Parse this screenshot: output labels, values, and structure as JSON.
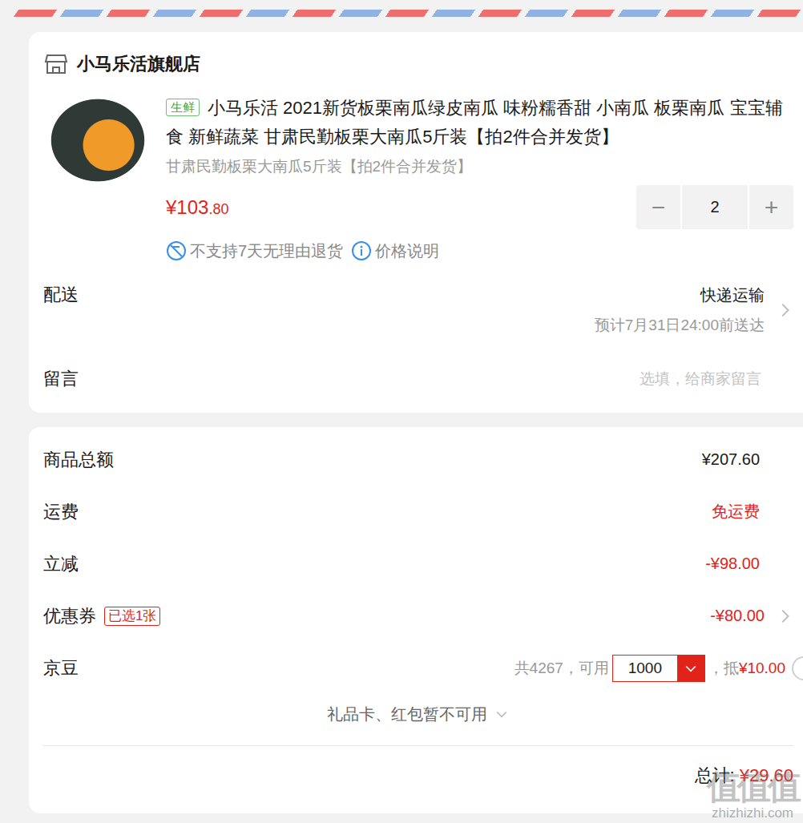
{
  "store": {
    "name": "小马乐活旗舰店"
  },
  "product": {
    "tag": "生鲜",
    "title": "小马乐活 2021新货板栗南瓜绿皮南瓜 味粉糯香甜 小南瓜 板栗南瓜 宝宝辅食 新鲜蔬菜 甘肃民勤板栗大南瓜5斤装【拍2件合并发货】",
    "spec": "甘肃民勤板栗大南瓜5斤装【拍2件合并发货】",
    "price_main": "¥103",
    "price_decimal": ".80",
    "quantity": "2",
    "minus": "−",
    "plus": "+",
    "notices": [
      {
        "label": "不支持7天无理由退货",
        "kind": "no-return"
      },
      {
        "label": "价格说明",
        "kind": "info"
      }
    ]
  },
  "delivery": {
    "label": "配送",
    "method": "快递运输",
    "eta": "预计7月31日24:00前送达"
  },
  "message": {
    "label": "留言",
    "placeholder": "选填，给商家留言"
  },
  "summary": [
    {
      "label": "商品总额",
      "value": "¥207.60",
      "kind": "plain"
    },
    {
      "label": "运费",
      "value": "免运费",
      "kind": "discount"
    },
    {
      "label": "立减",
      "value": "-¥98.00",
      "kind": "discount"
    },
    {
      "label": "优惠券",
      "badge": "已选1张",
      "value": "-¥80.00",
      "kind": "coupon"
    }
  ],
  "beans": {
    "label": "京豆",
    "available": "共4267，可用",
    "amount": "1000",
    "offset_prefix": "，抵",
    "offset": "¥10.00",
    "checked": false
  },
  "gift": {
    "label": "礼品卡、红包暂不可用"
  },
  "total": {
    "label": "总计:",
    "value": "¥29.60"
  },
  "watermark": {
    "logo": "值值值",
    "url": "zhizhizhi.com"
  }
}
